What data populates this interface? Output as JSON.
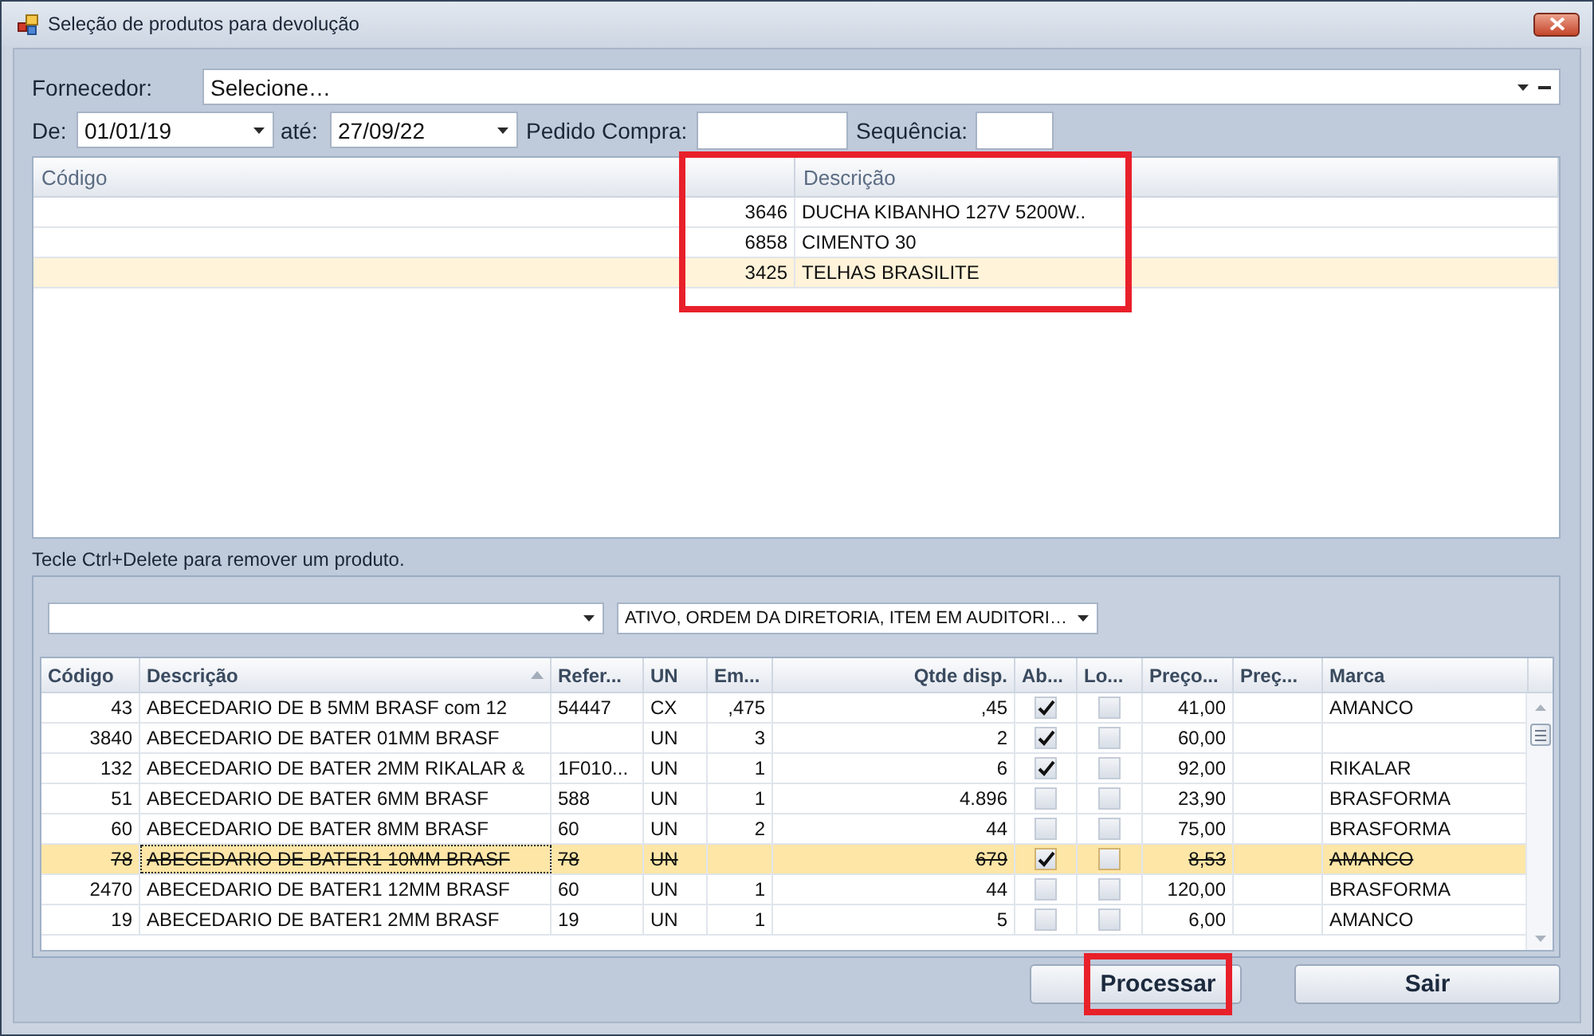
{
  "window": {
    "title": "Seleção de produtos para devolução"
  },
  "supplier": {
    "label": "Fornecedor:",
    "value": "Selecione…"
  },
  "date_from": {
    "label": "De:",
    "value": "01/01/19"
  },
  "date_to": {
    "label": "até:",
    "value": "27/09/22"
  },
  "purchase_order": {
    "label": "Pedido Compra:"
  },
  "sequence": {
    "label": "Sequência:"
  },
  "top_grid": {
    "highlighted": true,
    "columns": [
      {
        "label": "Código"
      },
      {
        "label": "Descrição"
      }
    ],
    "rows": [
      {
        "codigo": "3646",
        "descricao": "DUCHA KIBANHO 127V 5200W..",
        "selected": false
      },
      {
        "codigo": "6858",
        "descricao": "CIMENTO 30",
        "selected": false
      },
      {
        "codigo": "3425",
        "descricao": "TELHAS BRASILITE",
        "selected": true
      }
    ]
  },
  "hint": "Tecle Ctrl+Delete para remover um produto.",
  "filters": [
    {
      "kind": "combo"
    },
    {
      "kind": "combo",
      "value": "ATIVO, ORDEM DA DIRETORIA, ITEM EM AUDITORI…"
    }
  ],
  "products": {
    "columns": [
      {
        "label": "Código"
      },
      {
        "label": "Descrição",
        "sorted": true
      },
      {
        "label": "Refer..."
      },
      {
        "label": "UN"
      },
      {
        "label": "Em..."
      },
      {
        "label": "Qtde disp."
      },
      {
        "label": "Ab..."
      },
      {
        "label": "Lo..."
      },
      {
        "label": "Preço..."
      },
      {
        "label": "Preç..."
      },
      {
        "label": "Marca"
      }
    ],
    "rows": [
      {
        "codigo": "43",
        "descricao": "ABECEDARIO DE B 5MM BRASF com 12",
        "referencia": "54447",
        "un": "CX",
        "em": ",475",
        "qtde_disp": ",45",
        "ab": true,
        "lo": false,
        "preco": "41,00",
        "marca": "AMANCO",
        "selected": false,
        "strikethrough": false
      },
      {
        "codigo": "3840",
        "descricao": "ABECEDARIO DE BATER 01MM BRASF",
        "un": "UN",
        "em": "3",
        "qtde_disp": "2",
        "ab": true,
        "lo": false,
        "preco": "60,00",
        "selected": false,
        "strikethrough": false
      },
      {
        "codigo": "132",
        "descricao": "ABECEDARIO DE BATER 2MM RIKALAR &",
        "referencia": "1F010...",
        "un": "UN",
        "em": "1",
        "qtde_disp": "6",
        "ab": true,
        "lo": false,
        "preco": "92,00",
        "marca": "RIKALAR",
        "selected": false,
        "strikethrough": false
      },
      {
        "codigo": "51",
        "descricao": "ABECEDARIO DE BATER 6MM BRASF",
        "referencia": "588",
        "un": "UN",
        "em": "1",
        "qtde_disp": "4.896",
        "ab": false,
        "lo": false,
        "preco": "23,90",
        "marca": "BRASFORMA",
        "selected": false,
        "strikethrough": false
      },
      {
        "codigo": "60",
        "descricao": "ABECEDARIO DE BATER 8MM BRASF",
        "referencia": "60",
        "un": "UN",
        "em": "2",
        "qtde_disp": "44",
        "ab": false,
        "lo": false,
        "preco": "75,00",
        "marca": "BRASFORMA",
        "selected": false,
        "strikethrough": false
      },
      {
        "codigo": "78",
        "descricao": "ABECEDARIO DE BATER1 10MM BRASF",
        "referencia": "78",
        "un": "UN",
        "qtde_disp": "679",
        "ab": true,
        "lo": false,
        "preco": "8,53",
        "marca": "AMANCO",
        "selected": true,
        "strikethrough": true
      },
      {
        "codigo": "2470",
        "descricao": "ABECEDARIO DE BATER1 12MM BRASF",
        "referencia": "60",
        "un": "UN",
        "em": "1",
        "qtde_disp": "44",
        "ab": false,
        "lo": false,
        "preco": "120,00",
        "marca": "BRASFORMA",
        "selected": false,
        "strikethrough": false
      },
      {
        "codigo": "19",
        "descricao": "ABECEDARIO DE BATER1 2MM BRASF",
        "referencia": "19",
        "un": "UN",
        "em": "1",
        "qtde_disp": "5",
        "ab": false,
        "lo": false,
        "preco": "6,00",
        "marca": "AMANCO",
        "selected": false,
        "strikethrough": false
      }
    ]
  },
  "buttons": [
    {
      "label": "Processar",
      "highlighted": true
    },
    {
      "label": "Sair",
      "highlighted": false
    }
  ]
}
